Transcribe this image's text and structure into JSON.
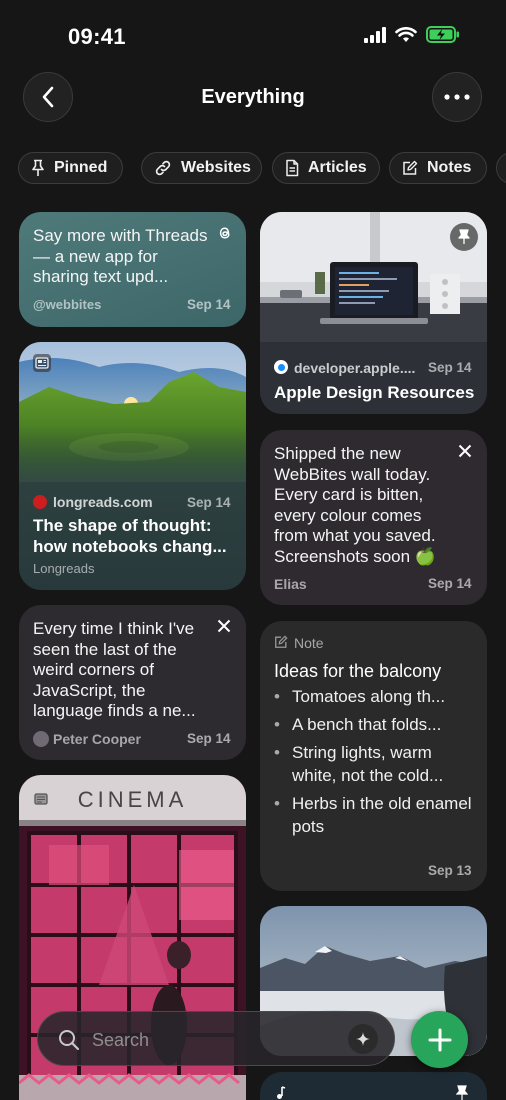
{
  "status": {
    "time": "09:41"
  },
  "header": {
    "title": "Everything"
  },
  "filters": [
    {
      "label": "Pinned",
      "icon": "pin-icon"
    },
    {
      "label": "Websites",
      "icon": "link-icon"
    },
    {
      "label": "Articles",
      "icon": "document-icon"
    },
    {
      "label": "Notes",
      "icon": "edit-note-icon"
    }
  ],
  "cards": {
    "threads": {
      "text": "Say more with Threads — a new app for sharing text upd...",
      "source": "@webbites",
      "date": "Sep 14",
      "icon": "threads-icon"
    },
    "apple": {
      "source": "developer.apple....",
      "date": "Sep 14",
      "title": "Apple Design Resources",
      "icon": "pin-icon"
    },
    "longreads": {
      "source": "longreads.com",
      "date": "Sep 14",
      "title": "The shape of thought: how notebooks chang...",
      "publisher": "Longreads",
      "icon": "article-icon"
    },
    "elias": {
      "text": "Shipped the new WebBites wall today. Every card is bitten, every colour comes from what you saved. Screenshots soon 🍏",
      "author": "Elias",
      "date": "Sep 14",
      "icon": "x-icon"
    },
    "peter": {
      "text": "Every time I think I've seen the last of the weird corners of JavaScript, the language finds a ne...",
      "author": "Peter Cooper",
      "date": "Sep 14",
      "icon": "x-icon"
    },
    "note": {
      "kind": "Note",
      "title": "Ideas for the balcony",
      "items": [
        "Tomatoes along th...",
        "A bench that folds...",
        "String lights, warm white, not the cold...",
        "Herbs in the old enamel pots"
      ],
      "date": "Sep 13"
    },
    "cinema": {
      "sign": "CINEMA"
    }
  },
  "search": {
    "placeholder": "Search"
  },
  "colors": {
    "accent_green": "#27a55a",
    "background": "#161616"
  }
}
